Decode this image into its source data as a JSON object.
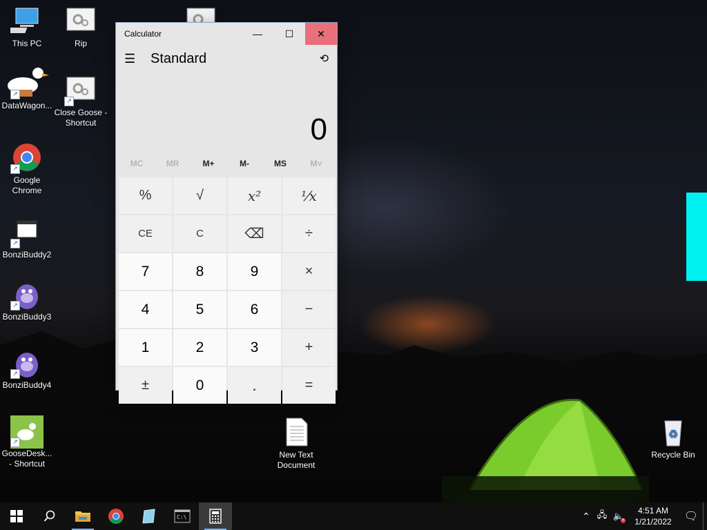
{
  "desktop": {
    "icons": [
      {
        "label": "This PC"
      },
      {
        "label": "Rip"
      },
      {
        "label": "DataWagon..."
      },
      {
        "label": "Close Goose - Shortcut"
      },
      {
        "label": "Google Chrome"
      },
      {
        "label": "BonziBuddy2"
      },
      {
        "label": "BonziBuddy3"
      },
      {
        "label": "BonziBuddy4"
      },
      {
        "label": "GooseDesk... - Shortcut"
      },
      {
        "label": "New Text Document"
      },
      {
        "label": "Recycle Bin"
      }
    ]
  },
  "calculator": {
    "title": "Calculator",
    "mode": "Standard",
    "display": "0",
    "memory": [
      "MC",
      "MR",
      "M+",
      "M-",
      "MS",
      "M˅"
    ],
    "keys": [
      "%",
      "√",
      "x²",
      "¹⁄x",
      "CE",
      "C",
      "⌫",
      "÷",
      "7",
      "8",
      "9",
      "×",
      "4",
      "5",
      "6",
      "−",
      "1",
      "2",
      "3",
      "+",
      "±",
      "0",
      ".",
      "="
    ]
  },
  "taskbar": {
    "time": "4:51 AM",
    "date": "1/21/2022"
  },
  "colors": {
    "accent_cyan": "#00f0f0",
    "close_button": "#e8707a",
    "taskbar": "#101010"
  }
}
